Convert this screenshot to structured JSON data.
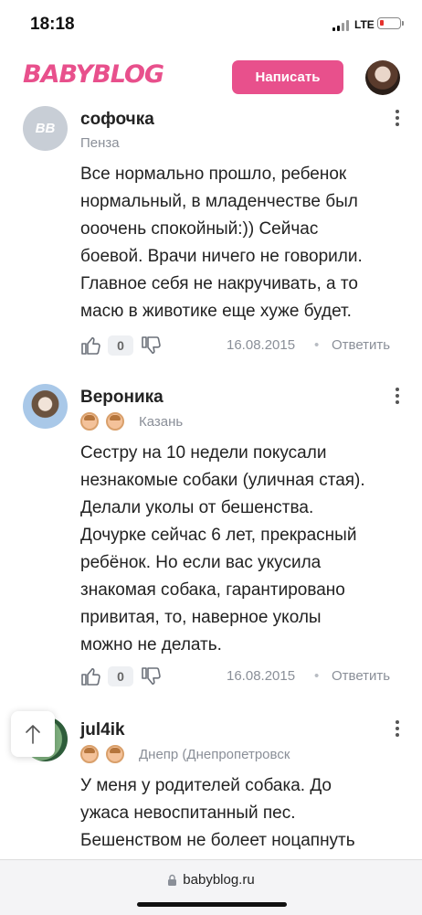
{
  "status_bar": {
    "time": "18:18",
    "network": "LTE"
  },
  "header": {
    "logo": "BABYBLOG",
    "write_button": "Написать"
  },
  "comments": [
    {
      "avatar_initials": "BB",
      "author": "софочка",
      "location": "Пенза",
      "lines": [
        "Все нормально прошло, ребенок",
        "нормальный, в младенчестве был",
        "ооочень спокойный:)) Сейчас",
        "боевой. Врачи ничего не говорили.",
        "Главное себя не накручивать, а то",
        "масю в животике еще хуже будет."
      ],
      "likes": "0",
      "date": "16.08.2015",
      "reply": "Ответить"
    },
    {
      "author": "Вероника",
      "location": "Казань",
      "lines": [
        "Сестру на 10 недели покусали",
        "незнакомые собаки (уличная стая).",
        "Делали уколы от бешенства.",
        "Дочурке сейчас 6 лет, прекрасный",
        "ребёнок. Но если вас укусила",
        "знакомая собака, гарантировано",
        "привитая, то, наверное уколы",
        "можно не делать."
      ],
      "likes": "0",
      "date": "16.08.2015",
      "reply": "Ответить"
    },
    {
      "author": "jul4ik",
      "location": "Днепр (Днепропетровск",
      "lines": [
        "У меня у родителей собака. До",
        "ужаса невоспитанный пес.",
        "Бешенством не болеет ноцапнуть"
      ]
    }
  ],
  "browser": {
    "url": "babyblog.ru"
  },
  "icons": [
    "thumb-up-icon",
    "thumb-down-icon",
    "more-icon",
    "arrow-up-icon",
    "lock-icon"
  ],
  "colors": {
    "brand": "#e8508c",
    "muted": "#8a8f98"
  }
}
